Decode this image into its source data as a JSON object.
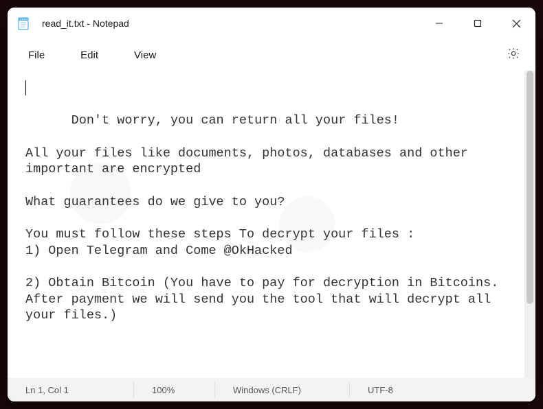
{
  "titlebar": {
    "app_icon": "notepad-icon",
    "title": "read_it.txt - Notepad"
  },
  "menubar": {
    "file": "File",
    "edit": "Edit",
    "view": "View"
  },
  "content": {
    "text": "Don't worry, you can return all your files!\n\nAll your files like documents, photos, databases and other important are encrypted\n\nWhat guarantees do we give to you?\n\nYou must follow these steps To decrypt your files :\n1) Open Telegram and Come @OkHacked\n\n2) Obtain Bitcoin (You have to pay for decryption in Bitcoins.\nAfter payment we will send you the tool that will decrypt all your files.)"
  },
  "statusbar": {
    "cursor": "Ln 1, Col 1",
    "zoom": "100%",
    "line_ending": "Windows (CRLF)",
    "encoding": "UTF-8"
  }
}
